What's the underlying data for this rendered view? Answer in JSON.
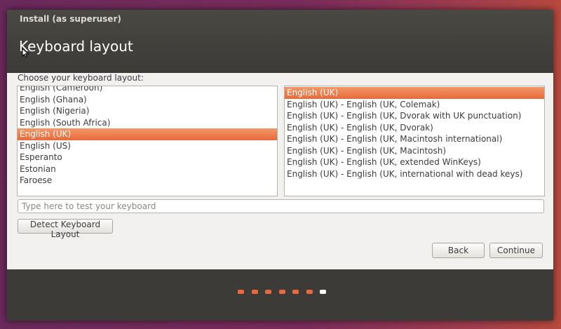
{
  "window": {
    "title": "Install (as superuser)",
    "heading": "Keyboard layout"
  },
  "prompt": "Choose your keyboard layout:",
  "layouts": {
    "items": [
      "English (Cameroon)",
      "English (Ghana)",
      "English (Nigeria)",
      "English (South Africa)",
      "English (UK)",
      "English (US)",
      "Esperanto",
      "Estonian",
      "Faroese"
    ],
    "selected": "English (UK)"
  },
  "variants": {
    "items": [
      "English (UK)",
      "English (UK) - English (UK, Colemak)",
      "English (UK) - English (UK, Dvorak with UK punctuation)",
      "English (UK) - English (UK, Dvorak)",
      "English (UK) - English (UK, Macintosh international)",
      "English (UK) - English (UK, Macintosh)",
      "English (UK) - English (UK, extended WinKeys)",
      "English (UK) - English (UK, international with dead keys)"
    ],
    "selected": "English (UK)"
  },
  "test_input": {
    "placeholder": "Type here to test your keyboard",
    "value": ""
  },
  "buttons": {
    "detect": "Detect Keyboard Layout",
    "back": "Back",
    "continue": "Continue"
  },
  "progress": {
    "total_steps": 7,
    "current_step": 7
  },
  "colors": {
    "accent": "#e8693a",
    "titlebar": "#3d3b37",
    "footer": "#3c3b37"
  }
}
